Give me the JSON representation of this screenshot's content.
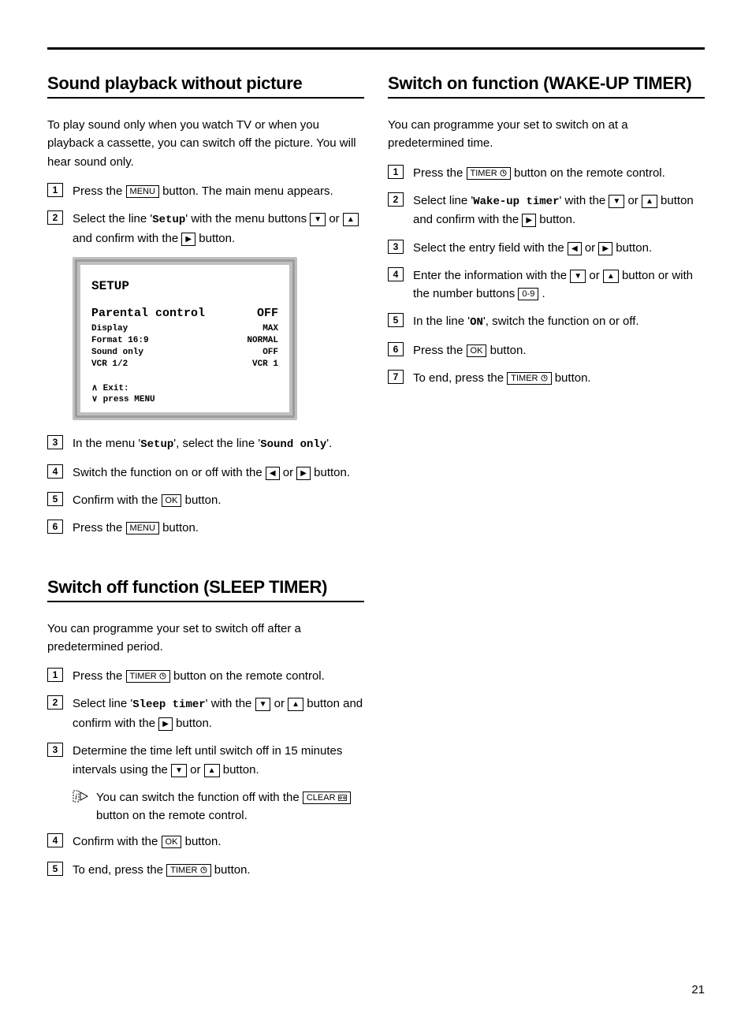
{
  "page_number": "21",
  "keys": {
    "menu": "MENU",
    "ok": "OK",
    "timer": "TIMER",
    "clear": "CLEAR",
    "num09": "0-9",
    "up": "▲",
    "down": "▼",
    "left": "◀",
    "right": "▶"
  },
  "left": {
    "sec1": {
      "heading": "Sound playback without picture",
      "intro": "To play sound only when you watch TV or when you playback a cassette, you can switch off the picture. You will hear sound only.",
      "step1_a": "Press the ",
      "step1_b": " button. The main menu appears.",
      "step2_a": "Select the line '",
      "step2_label": "Setup",
      "step2_b": "' with the menu buttons ",
      "step2_c": " or ",
      "step2_d": " and confirm with the ",
      "step2_e": " button.",
      "step3_a": "In the menu '",
      "step3_l1": "Setup",
      "step3_b": "', select the line '",
      "step3_l2": "Sound only",
      "step3_c": "'.",
      "step4_a": "Switch the function on or off with the ",
      "step4_b": " or ",
      "step4_c": " button.",
      "step5_a": "Confirm with the ",
      "step5_b": " button.",
      "step6_a": "Press the ",
      "step6_b": " button.",
      "osd": {
        "title": "SETUP",
        "rows": [
          {
            "k": "Parental control",
            "v": "OFF",
            "big": true
          },
          {
            "k": "Display",
            "v": "MAX"
          },
          {
            "k": "Format 16:9",
            "v": "NORMAL"
          },
          {
            "k": "Sound only",
            "v": "OFF"
          },
          {
            "k": "VCR 1/2",
            "v": "VCR 1"
          }
        ],
        "exit1": "∧ Exit:",
        "exit2": "∨ press MENU"
      }
    },
    "sec2": {
      "heading": "Switch off function (SLEEP TIMER)",
      "intro": "You can programme your set to switch off after a predetermined period.",
      "step1_a": "Press the ",
      "step1_b": " button on the remote control.",
      "step2_a": "Select line '",
      "step2_label": "Sleep timer",
      "step2_b": "' with the ",
      "step2_c": " or ",
      "step2_d": " button and confirm with the ",
      "step2_e": " button.",
      "step3_a": "Determine the time left until switch off in 15 minutes intervals using the ",
      "step3_b": " or ",
      "step3_c": " button.",
      "tip_a": "You can switch the function off with the ",
      "tip_b": " button on the remote control.",
      "step4_a": "Confirm with the ",
      "step4_b": " button.",
      "step5_a": "To end, press the ",
      "step5_b": " button."
    }
  },
  "right": {
    "sec1": {
      "heading": "Switch on function (WAKE-UP TIMER)",
      "intro": "You can programme your set to switch on at a predetermined time.",
      "step1_a": "Press the ",
      "step1_b": " button on the remote control.",
      "step2_a": "Select line '",
      "step2_label": "Wake-up timer",
      "step2_b": "' with the ",
      "step2_c": " or ",
      "step2_d": " button and confirm with the ",
      "step2_e": " button.",
      "step3_a": "Select the entry field with the ",
      "step3_b": " or ",
      "step3_c": " button.",
      "step4_a": "Enter the information with the ",
      "step4_b": " or ",
      "step4_c": " button or with the number buttons ",
      "step4_d": ".",
      "step5_a": "In the line '",
      "step5_label": "ON",
      "step5_b": "', switch the function on or off.",
      "step6_a": "Press the ",
      "step6_b": " button.",
      "step7_a": "To end, press the ",
      "step7_b": " button."
    }
  }
}
